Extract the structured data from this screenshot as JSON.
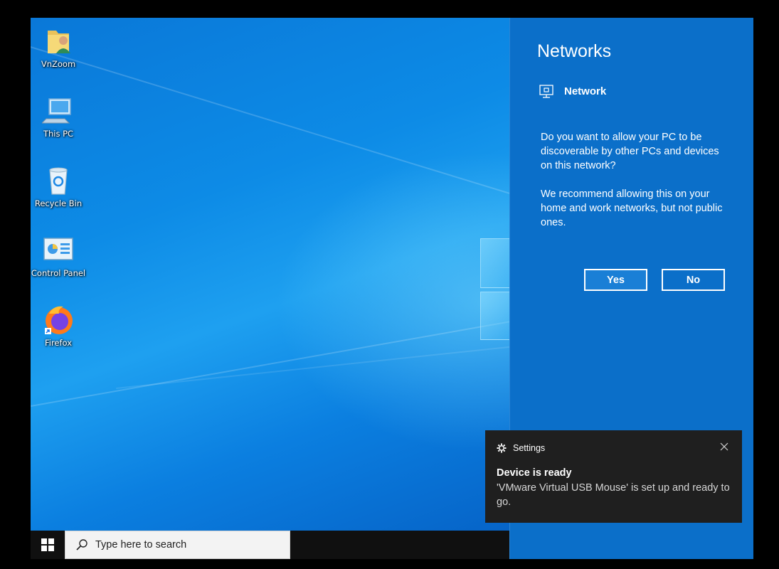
{
  "desktop": {
    "icons": [
      {
        "label": "VnZoom",
        "icon": "user-folder-icon"
      },
      {
        "label": "This PC",
        "icon": "computer-icon"
      },
      {
        "label": "Recycle Bin",
        "icon": "recycle-bin-icon"
      },
      {
        "label": "Control Panel",
        "icon": "control-panel-icon"
      },
      {
        "label": "Firefox",
        "icon": "firefox-icon"
      }
    ]
  },
  "taskbar": {
    "start_icon": "windows-logo-icon",
    "search_placeholder": "Type here to search",
    "search_icon": "search-icon"
  },
  "networks_flyout": {
    "title": "Networks",
    "network_name": "Network",
    "network_icon": "ethernet-icon",
    "prompt": "Do you want to allow your PC to be discoverable by other PCs and devices on this network?",
    "recommendation": "We recommend allowing this on your home and work networks, but not public ones.",
    "yes_label": "Yes",
    "no_label": "No"
  },
  "toast": {
    "app_name": "Settings",
    "app_icon": "gear-icon",
    "title": "Device is ready",
    "body": "'VMware Virtual USB Mouse' is set up and ready to go."
  },
  "colors": {
    "flyout_bg": "#0b6fc9",
    "toast_bg": "#1f1f1f",
    "taskbar_bg": "#101010"
  }
}
